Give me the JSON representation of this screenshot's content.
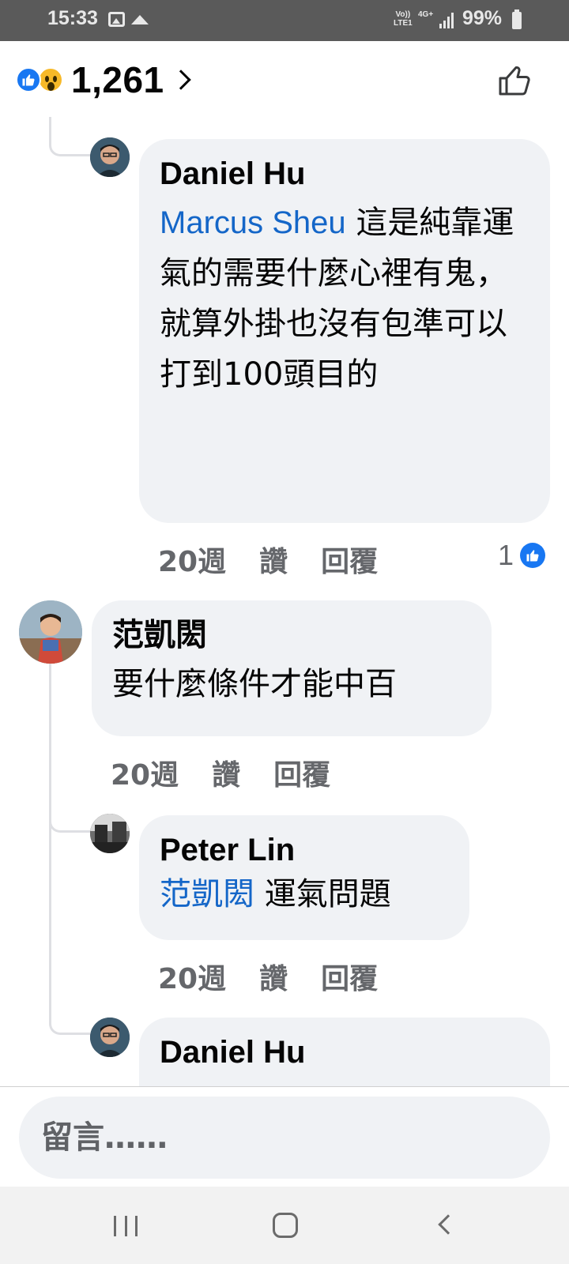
{
  "status_bar": {
    "time": "15:33",
    "volte": "Vo)) LTE1",
    "network": "4G+",
    "battery": "99%"
  },
  "reactions": {
    "count": "1,261",
    "types": [
      "like-icon",
      "wow-icon"
    ]
  },
  "comments": [
    {
      "author": "Daniel Hu",
      "mention": "Marcus Sheu",
      "text": " 這是純靠運氣的需要什麼心裡有鬼，就算外掛也沒有包準可以打到100頭目的",
      "time": "20週",
      "like_label": "讚",
      "reply_label": "回覆",
      "likes": "1"
    },
    {
      "author": "范凱閎",
      "text": "要什麼條件才能中百",
      "time": "20週",
      "like_label": "讚",
      "reply_label": "回覆"
    },
    {
      "author": "Peter Lin",
      "mention": "范凱閎",
      "text": " 運氣問題",
      "time": "20週",
      "like_label": "讚",
      "reply_label": "回覆"
    },
    {
      "author": "Daniel Hu"
    }
  ],
  "composer": {
    "placeholder": "留言……"
  },
  "colors": {
    "facebook_blue": "#1877f2",
    "mention_blue": "#1466c8",
    "bubble_bg": "#f0f2f5",
    "meta_gray": "#65676b"
  }
}
